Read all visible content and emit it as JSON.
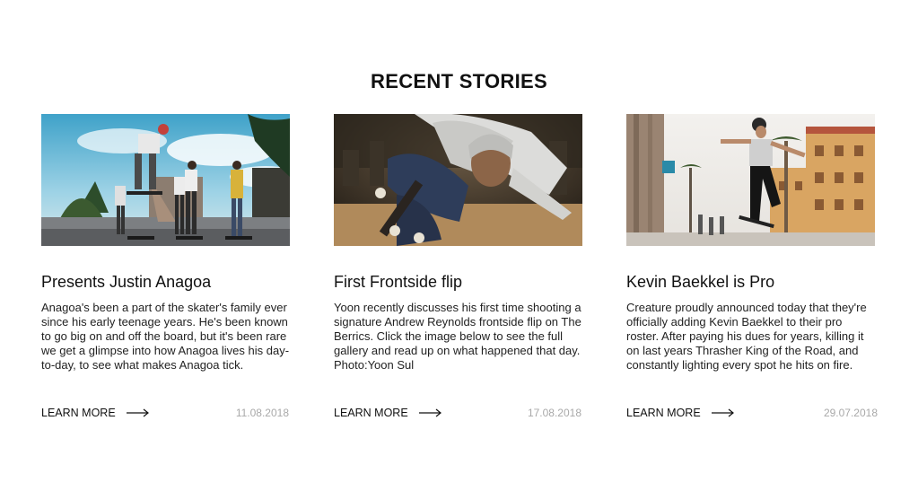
{
  "section": {
    "title": "RECENT STORIES"
  },
  "stories": [
    {
      "title": "Presents Justin Anagoa",
      "body": "Anagoa's been a part of the skater's family ever since his early teenage years. He's been known to go big on and off the board, but it's been rare we get a glimpse into how Anagoa lives his day-to-day, to see what makes Anagoa tick.",
      "cta": "LEARN MORE",
      "date": "11.08.2018"
    },
    {
      "title": "First Frontside flip",
      "body": "Yoon recently discusses his first time shooting a signature Andrew Reynolds frontside flip on The Berrics. Click the image below to see the full gallery and read up on what happened that day. Photo:Yoon Sul",
      "cta": "LEARN MORE",
      "date": "17.08.2018"
    },
    {
      "title": "Kevin Baekkel is Pro",
      "body": "Creature proudly announced today that they're officially adding Kevin Baekkel to their pro roster. After paying his dues for years, killing it on last years Thrasher King of the Road, and constantly lighting every spot he hits on fire.",
      "cta": "LEARN MORE",
      "date": "29.07.2018"
    }
  ]
}
